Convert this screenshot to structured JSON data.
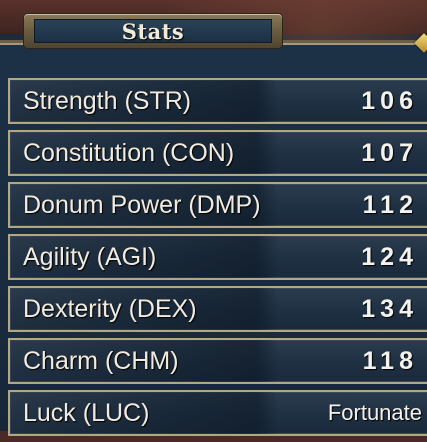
{
  "header": {
    "title": "Stats"
  },
  "stats": [
    {
      "label": "Strength (STR)",
      "value": "106"
    },
    {
      "label": "Constitution (CON)",
      "value": "107"
    },
    {
      "label": "Donum Power (DMP)",
      "value": "112"
    },
    {
      "label": "Agility (AGI)",
      "value": "124"
    },
    {
      "label": "Dexterity (DEX)",
      "value": "134"
    },
    {
      "label": "Charm (CHM)",
      "value": "118"
    },
    {
      "label": "Luck (LUC)",
      "value": "Fortunate"
    }
  ],
  "colors": {
    "panel": "#1c3147",
    "border": "#b3a683",
    "text": "#f1ebdf"
  }
}
